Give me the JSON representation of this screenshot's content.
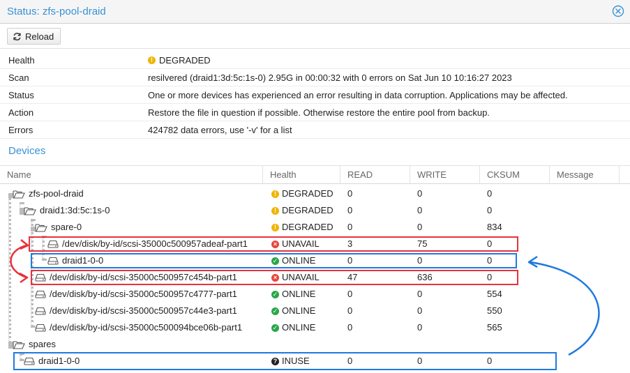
{
  "window": {
    "title": "Status: zfs-pool-draid"
  },
  "toolbar": {
    "reload_label": "Reload"
  },
  "info": [
    {
      "key": "Health",
      "value": "DEGRADED",
      "icon": "warning-icon"
    },
    {
      "key": "Scan",
      "value": "resilvered (draid1:3d:5c:1s-0) 2.95G in 00:00:32 with 0 errors on Sat Jun 10 10:16:27 2023"
    },
    {
      "key": "Status",
      "value": "One or more devices has experienced an error resulting in data corruption. Applications may be affected."
    },
    {
      "key": "Action",
      "value": "Restore the file in question if possible. Otherwise restore the entire pool from backup."
    },
    {
      "key": "Errors",
      "value": "424782 data errors, use '-v' for a list"
    }
  ],
  "devices": {
    "title": "Devices",
    "columns": [
      "Name",
      "Health",
      "READ",
      "WRITE",
      "CKSUM",
      "Message"
    ],
    "rows": [
      {
        "name": "zfs-pool-draid",
        "type": "folder",
        "health": "DEGRADED",
        "read": "0",
        "write": "0",
        "cksum": "0"
      },
      {
        "name": "draid1:3d:5c:1s-0",
        "type": "folder",
        "health": "DEGRADED",
        "read": "0",
        "write": "0",
        "cksum": "0"
      },
      {
        "name": "spare-0",
        "type": "folder",
        "health": "DEGRADED",
        "read": "0",
        "write": "0",
        "cksum": "834"
      },
      {
        "name": "/dev/disk/by-id/scsi-35000c500957adeaf-part1",
        "type": "disk",
        "health": "UNAVAIL",
        "read": "3",
        "write": "75",
        "cksum": "0"
      },
      {
        "name": "draid1-0-0",
        "type": "disk",
        "health": "ONLINE",
        "read": "0",
        "write": "0",
        "cksum": "0"
      },
      {
        "name": "/dev/disk/by-id/scsi-35000c500957c454b-part1",
        "type": "disk",
        "health": "UNAVAIL",
        "read": "47",
        "write": "636",
        "cksum": "0"
      },
      {
        "name": "/dev/disk/by-id/scsi-35000c500957c4777-part1",
        "type": "disk",
        "health": "ONLINE",
        "read": "0",
        "write": "0",
        "cksum": "554"
      },
      {
        "name": "/dev/disk/by-id/scsi-35000c500957c44e3-part1",
        "type": "disk",
        "health": "ONLINE",
        "read": "0",
        "write": "0",
        "cksum": "550"
      },
      {
        "name": "/dev/disk/by-id/scsi-35000c500094bce06b-part1",
        "type": "disk",
        "health": "ONLINE",
        "read": "0",
        "write": "0",
        "cksum": "565"
      },
      {
        "name": "spares",
        "type": "folder",
        "health": "",
        "read": "",
        "write": "",
        "cksum": ""
      },
      {
        "name": "draid1-0-0",
        "type": "disk",
        "health": "INUSE",
        "read": "0",
        "write": "0",
        "cksum": "0"
      }
    ]
  },
  "colors": {
    "accent": "#3892d4",
    "degraded": "#f0b400",
    "unavail": "#e8453c",
    "online": "#2aa64a",
    "inuse": "#222222",
    "annotation_red": "#e8313c",
    "annotation_blue": "#1f7ae0"
  }
}
